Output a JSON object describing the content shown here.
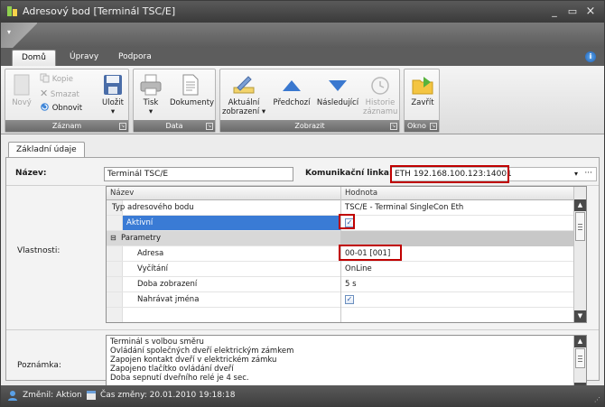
{
  "window": {
    "title": "Adresový bod [Terminál TSC/E]",
    "controls": {
      "minimize": "_",
      "maximize": "▭",
      "close": "×"
    }
  },
  "ribbon": {
    "tabs": [
      {
        "label": "Domů",
        "active": true
      },
      {
        "label": "Úpravy",
        "active": false
      },
      {
        "label": "Podpora",
        "active": false
      }
    ],
    "groups": {
      "zaznam": {
        "label": "Záznam",
        "novy": "Nový",
        "kopie": "Kopie",
        "smazat": "Smazat",
        "obnovit": "Obnovit",
        "ulozit": "Uložit"
      },
      "data": {
        "label": "Data",
        "tisk": "Tisk",
        "dokumenty": "Dokumenty"
      },
      "zobrazit": {
        "label": "Zobrazit",
        "aktualni_line1": "Aktuální",
        "aktualni_line2": "zobrazení",
        "predchozi": "Předchozí",
        "nasledujici": "Následující",
        "historie_line1": "Historie",
        "historie_line2": "záznamu"
      },
      "okno": {
        "label": "Okno",
        "zavrit": "Zavřít"
      }
    }
  },
  "form": {
    "tab_label": "Základní údaje",
    "nazev_label": "Název:",
    "nazev_value": "Terminál TSC/E",
    "linka_label": "Komunikační linka:",
    "linka_value": "ETH 192.168.100.123:14001",
    "vlastnosti_label": "Vlastnosti:",
    "poznamka_label": "Poznámka:"
  },
  "property_grid": {
    "header_name": "Název",
    "header_value": "Hodnota",
    "rows": [
      {
        "name": "Typ adresového bodu",
        "value": "TSC/E - Terminal SingleCon Eth"
      },
      {
        "name": "Aktivní",
        "value": "✓",
        "selected": true
      },
      {
        "name": "Parametry",
        "value": "",
        "category": true
      },
      {
        "name": "Adresa",
        "value": "00-01 [001]"
      },
      {
        "name": "Vyčítání",
        "value": "OnLine"
      },
      {
        "name": "Doba zobrazení",
        "value": "5 s"
      },
      {
        "name": "Nahrávat jména",
        "value": "✓"
      }
    ]
  },
  "notes": {
    "lines": [
      "Terminál s volbou směru",
      "Ovládání společných dveří elektrickým zámkem",
      "Zapojen kontakt dveří v elektrickém zámku",
      "Zapojeno tlačítko ovládání dveří",
      "Doba sepnutí dveřního relé je 4 sec."
    ]
  },
  "status": {
    "changed_by": "Změnil: Aktion",
    "changed_at": "Čas změny: 20.01.2010 19:18:18"
  },
  "colors": {
    "highlight_red": "#c00000",
    "selection_blue": "#3a7bd5"
  }
}
